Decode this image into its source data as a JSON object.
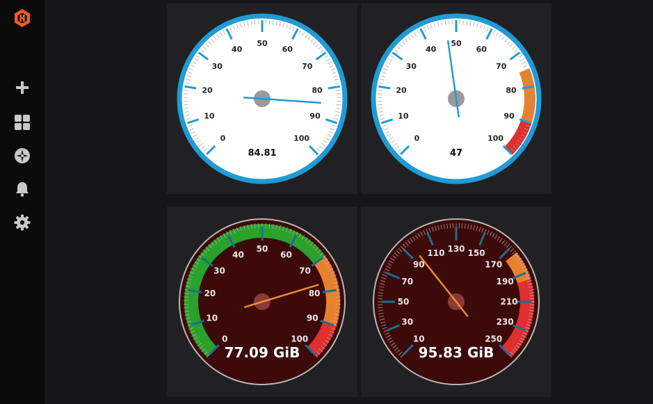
{
  "sidebar": {
    "logo_icon": "grafana-logo-icon",
    "items": [
      {
        "name": "create",
        "icon": "plus-icon"
      },
      {
        "name": "dashboards",
        "icon": "dashboards-grid-icon"
      },
      {
        "name": "explore",
        "icon": "compass-icon"
      },
      {
        "name": "alerting",
        "icon": "bell-icon"
      },
      {
        "name": "configuration",
        "icon": "gear-icon"
      }
    ]
  },
  "colors": {
    "accent": "#1f9bd6",
    "logo": "#f05a28",
    "green": "#2aa12a",
    "orange": "#e8812e",
    "red": "#e02f2f",
    "needle_light": "#1f9bd6",
    "needle_dark": "#ef8b2c"
  },
  "chart_data": [
    {
      "type": "gauge",
      "style": "light",
      "min": 0,
      "max": 100,
      "value": 84.81,
      "value_label": "84.81",
      "tick_labels": [
        "0",
        "10",
        "20",
        "30",
        "40",
        "50",
        "60",
        "70",
        "80",
        "90",
        "100"
      ],
      "bands": []
    },
    {
      "type": "gauge",
      "style": "light",
      "min": 0,
      "max": 100,
      "value": 47,
      "value_label": "47",
      "tick_labels": [
        "0",
        "10",
        "20",
        "30",
        "40",
        "50",
        "60",
        "70",
        "80",
        "90",
        "100"
      ],
      "bands": [
        {
          "from": 75,
          "to": 90,
          "color": "#e8812e"
        },
        {
          "from": 90,
          "to": 100,
          "color": "#e02f2f"
        }
      ]
    },
    {
      "type": "gauge",
      "style": "dark",
      "min": 0,
      "max": 100,
      "value": 77.09,
      "value_label": "77.09 GiB",
      "tick_labels": [
        "0",
        "10",
        "20",
        "30",
        "40",
        "50",
        "60",
        "70",
        "80",
        "90",
        "100"
      ],
      "bands": [
        {
          "from": 0,
          "to": 70,
          "color": "#2aa12a"
        },
        {
          "from": 70,
          "to": 90,
          "color": "#e8812e"
        },
        {
          "from": 90,
          "to": 100,
          "color": "#e02f2f"
        }
      ]
    },
    {
      "type": "gauge",
      "style": "dark",
      "min": 10,
      "max": 250,
      "value": 95.83,
      "value_label": "95.83 GiB",
      "tick_labels": [
        "10",
        "30",
        "50",
        "70",
        "90",
        "110",
        "130",
        "150",
        "170",
        "190",
        "210",
        "230",
        "250"
      ],
      "bands": [
        {
          "from": 175,
          "to": 195,
          "color": "#e8812e"
        },
        {
          "from": 195,
          "to": 250,
          "color": "#e02f2f"
        }
      ]
    }
  ]
}
